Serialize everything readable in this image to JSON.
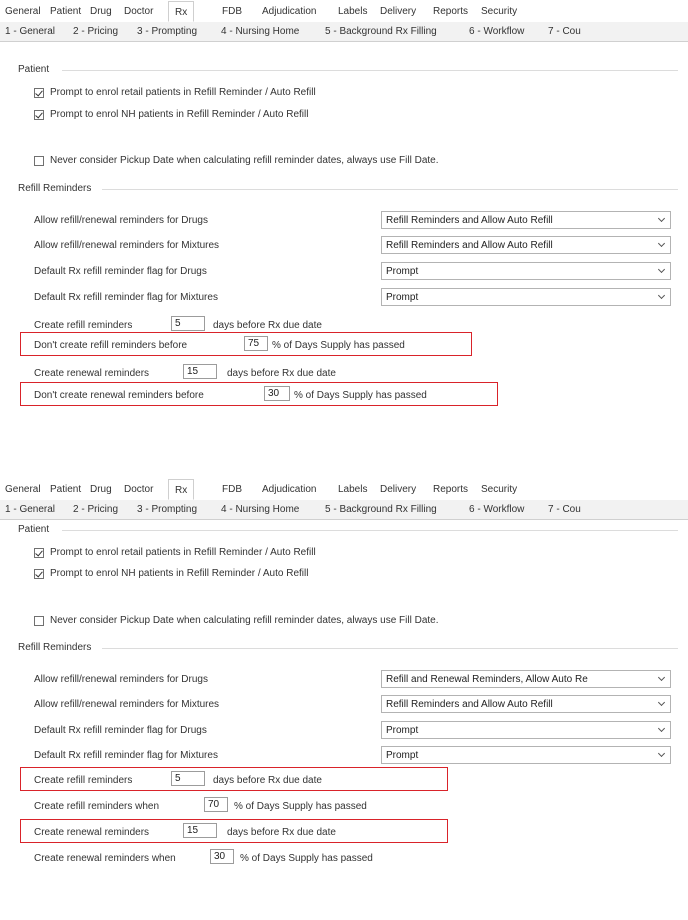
{
  "main_tabs": [
    "General",
    "Patient",
    "Drug",
    "Doctor",
    "Rx",
    "FDB",
    "Adjudication",
    "Labels",
    "Delivery",
    "Reports",
    "Security"
  ],
  "sub_tabs": [
    "1 - General",
    "2 - Pricing",
    "3 - Prompting",
    "4 - Nursing Home",
    "5 - Background Rx Filling",
    "6 - Workflow",
    "7 - Cou"
  ],
  "patient_section": {
    "title": "Patient",
    "checkbox_retail": "Prompt to enrol retail patients in Refill Reminder / Auto Refill",
    "checkbox_nh": "Prompt to enrol NH patients in Refill Reminder / Auto Refill"
  },
  "never_consider": "Never consider Pickup Date when calculating refill reminder dates, always use Fill Date.",
  "refill_section_title": "Refill Reminders",
  "labels": {
    "allow_drugs": "Allow refill/renewal reminders for Drugs",
    "allow_mixtures": "Allow refill/renewal reminders for Mixtures",
    "default_drugs": "Default Rx refill reminder flag for Drugs",
    "default_mixtures": "Default Rx refill reminder flag for Mixtures",
    "create_refill": "Create refill reminders",
    "days_before_due": "days before Rx due date",
    "dont_create_refill": "Don't create refill reminders before",
    "pct_days_supply": "% of Days Supply has passed",
    "create_renewal": "Create renewal reminders",
    "dont_create_renewal": "Don't create renewal reminders before",
    "create_refill_when": "Create refill reminders when",
    "create_renewal_when": "Create renewal reminders when"
  },
  "panel1": {
    "allow_drugs_value": "Refill Reminders and Allow Auto Refill",
    "allow_mixtures_value": "Refill Reminders and Allow Auto Refill",
    "default_drugs_value": "Prompt",
    "default_mixtures_value": "Prompt",
    "refill_days": "5",
    "refill_pct": "75",
    "renewal_days": "15",
    "renewal_pct": "30"
  },
  "panel2": {
    "allow_drugs_value": "Refill and Renewal Reminders, Allow Auto Re",
    "allow_mixtures_value": "Refill Reminders and Allow Auto Refill",
    "default_drugs_value": "Prompt",
    "default_mixtures_value": "Prompt",
    "refill_days": "5",
    "refill_pct": "70",
    "renewal_days": "15",
    "renewal_pct": "30"
  },
  "colors": {
    "highlight_red": "#d9232a",
    "tab_strip": "#f2f2f2"
  }
}
